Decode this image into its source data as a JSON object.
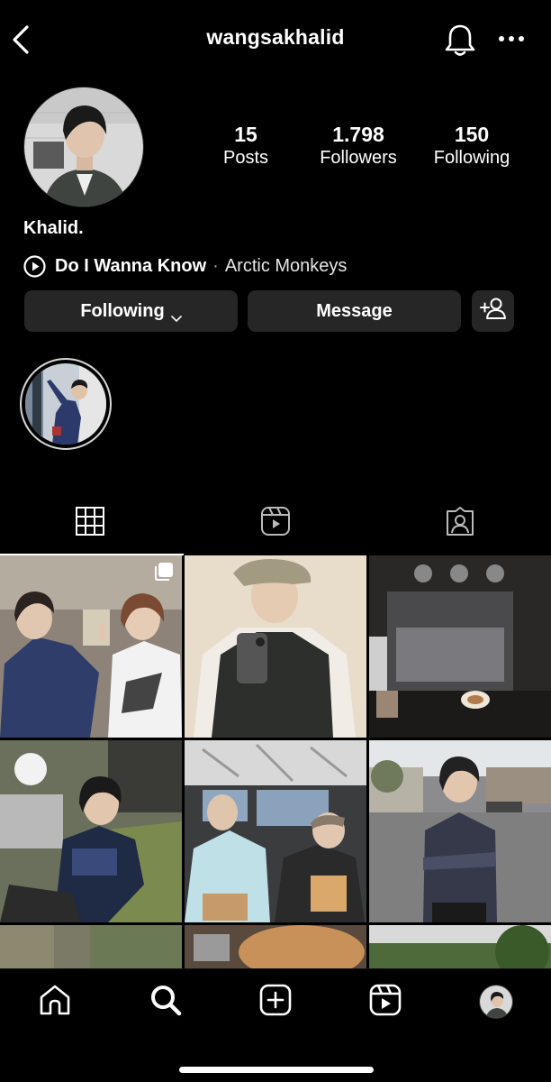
{
  "header": {
    "username": "wangsakhalid"
  },
  "profile": {
    "display_name": "Khalid.",
    "stats": [
      {
        "value": "15",
        "label": "Posts"
      },
      {
        "value": "1.798",
        "label": "Followers"
      },
      {
        "value": "150",
        "label": "Following"
      }
    ],
    "music": {
      "song": "Do I Wanna Know",
      "separator": "·",
      "artist": "Arctic Monkeys"
    }
  },
  "actions": {
    "following_label": "Following",
    "message_label": "Message"
  },
  "tabs": [
    {
      "icon": "grid-icon",
      "selected": true
    },
    {
      "icon": "reels-icon",
      "selected": false
    },
    {
      "icon": "tagged-icon",
      "selected": false
    }
  ],
  "grid": {
    "post_count_visible": 9,
    "first_post_is_carousel": true
  },
  "bottom_nav": [
    {
      "icon": "home-icon"
    },
    {
      "icon": "search-icon",
      "selected": true
    },
    {
      "icon": "create-post-icon"
    },
    {
      "icon": "reels-icon"
    },
    {
      "icon": "profile-avatar"
    }
  ],
  "colors": {
    "background": "#000000",
    "button_bg": "#262626",
    "text": "#ffffff",
    "secondary_text": "#aaaaaa"
  }
}
